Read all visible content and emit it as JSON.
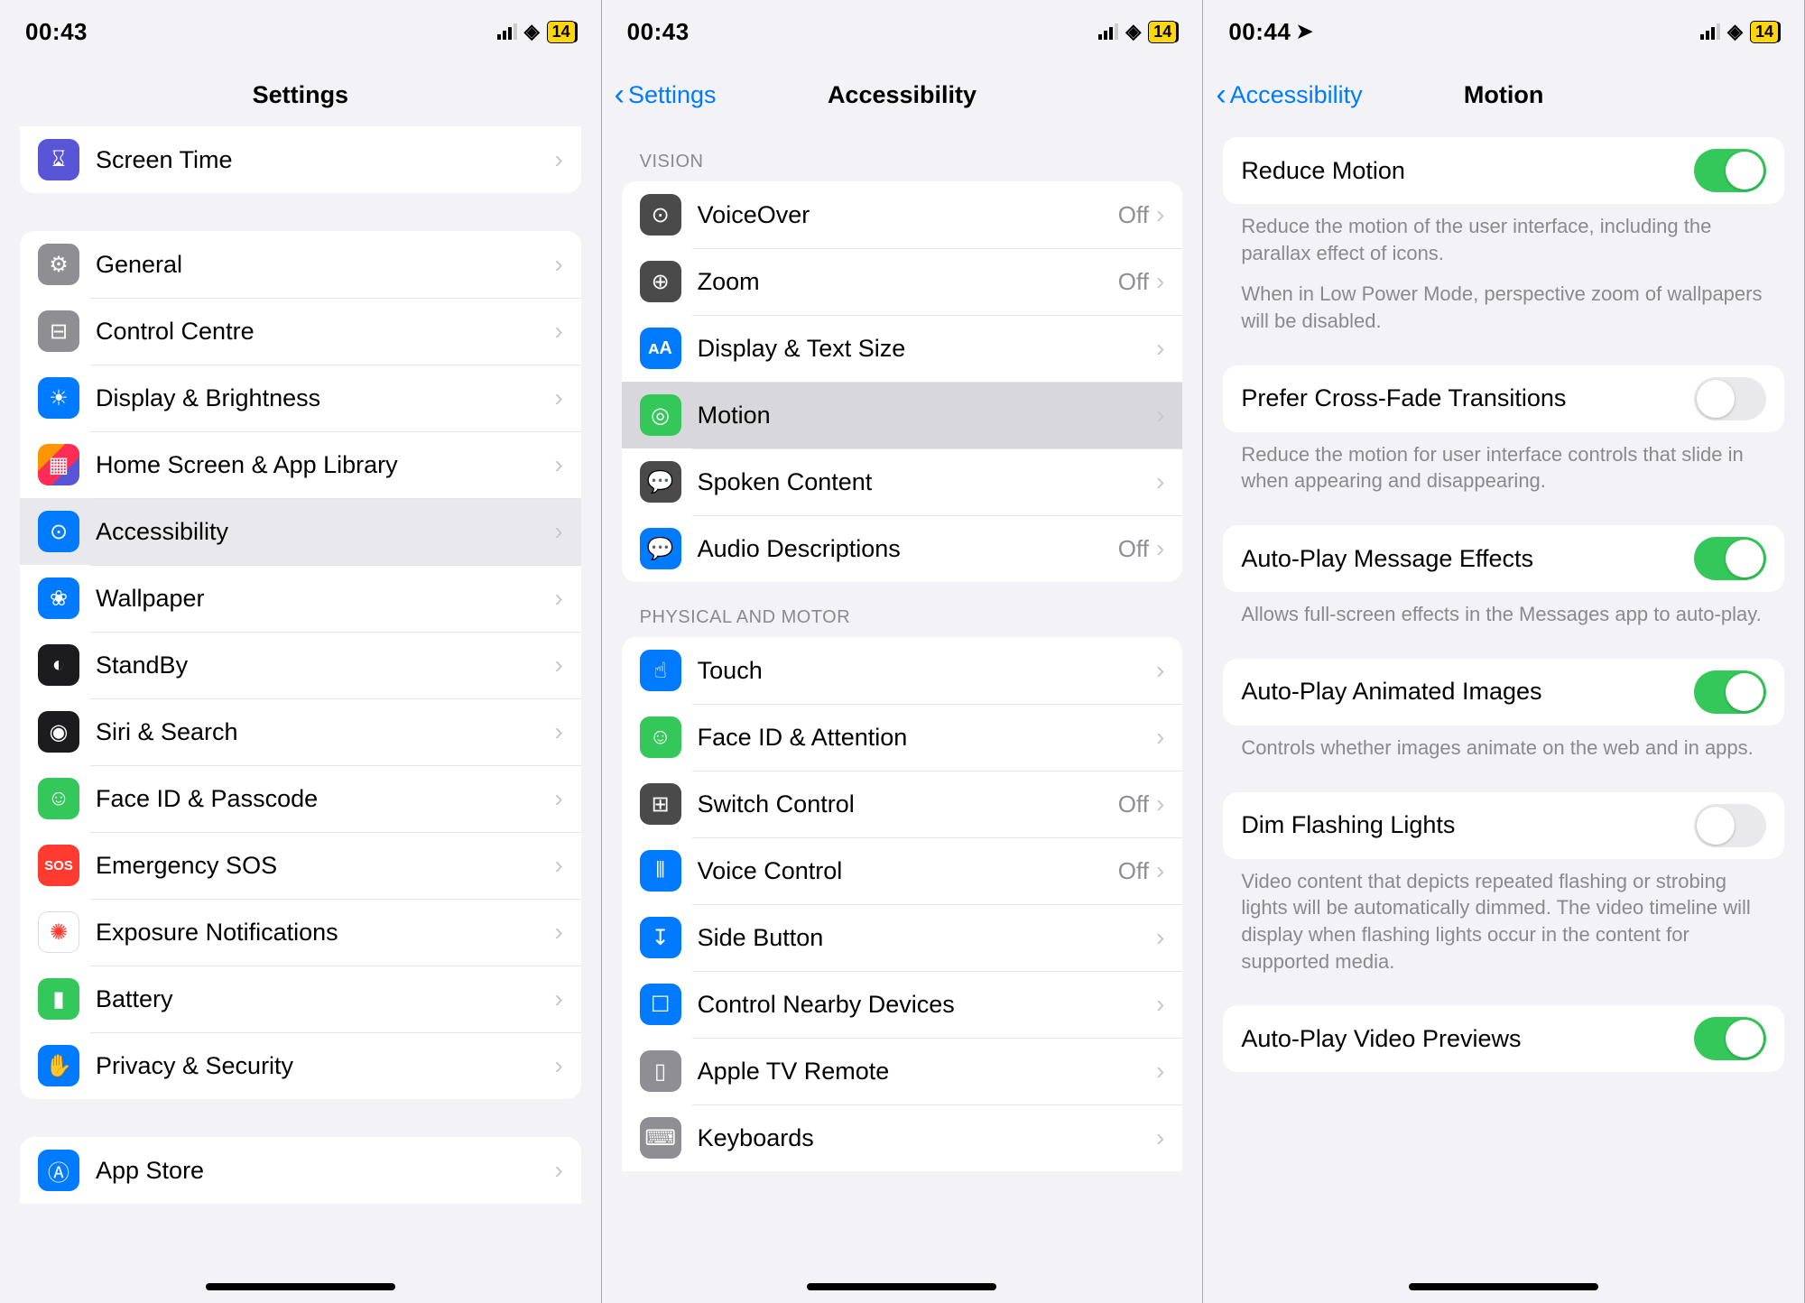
{
  "pane1": {
    "status": {
      "time": "00:43",
      "battery": "14"
    },
    "title": "Settings",
    "top_item": {
      "label": "Screen Time",
      "iconbg": "bg-purple",
      "glyph": "⌛︎"
    },
    "group": [
      {
        "label": "General",
        "iconbg": "bg-gray",
        "glyph": "⚙︎"
      },
      {
        "label": "Control Centre",
        "iconbg": "bg-gray",
        "glyph": "⊟"
      },
      {
        "label": "Display & Brightness",
        "iconbg": "bg-blue",
        "glyph": "☀︎"
      },
      {
        "label": "Home Screen & App Library",
        "iconbg": "bg-multicolor",
        "glyph": "▦"
      },
      {
        "label": "Accessibility",
        "iconbg": "bg-blue",
        "glyph": "⊙",
        "active": true
      },
      {
        "label": "Wallpaper",
        "iconbg": "bg-blue",
        "glyph": "❀"
      },
      {
        "label": "StandBy",
        "iconbg": "bg-black",
        "glyph": "◐"
      },
      {
        "label": "Siri & Search",
        "iconbg": "bg-black",
        "glyph": "◉"
      },
      {
        "label": "Face ID & Passcode",
        "iconbg": "bg-green",
        "glyph": "☺︎"
      },
      {
        "label": "Emergency SOS",
        "iconbg": "bg-red",
        "glyph": "SOS"
      },
      {
        "label": "Exposure Notifications",
        "iconbg": "bg-white",
        "glyph": "✺"
      },
      {
        "label": "Battery",
        "iconbg": "bg-green",
        "glyph": "▮"
      },
      {
        "label": "Privacy & Security",
        "iconbg": "bg-blue",
        "glyph": "✋"
      }
    ],
    "appstore": {
      "label": "App Store",
      "iconbg": "bg-blue",
      "glyph": "Ⓐ"
    }
  },
  "pane2": {
    "status": {
      "time": "00:43",
      "battery": "14"
    },
    "back": "Settings",
    "title": "Accessibility",
    "vision_header": "VISION",
    "vision": [
      {
        "label": "VoiceOver",
        "iconbg": "bg-darkgray",
        "glyph": "⊙",
        "value": "Off"
      },
      {
        "label": "Zoom",
        "iconbg": "bg-darkgray",
        "glyph": "⊕",
        "value": "Off"
      },
      {
        "label": "Display & Text Size",
        "iconbg": "bg-blue",
        "glyph": "ᴀA"
      },
      {
        "label": "Motion",
        "iconbg": "bg-green",
        "glyph": "◎",
        "selected": true
      },
      {
        "label": "Spoken Content",
        "iconbg": "bg-darkgray",
        "glyph": "💬"
      },
      {
        "label": "Audio Descriptions",
        "iconbg": "bg-blue",
        "glyph": "💬",
        "value": "Off"
      }
    ],
    "physical_header": "PHYSICAL AND MOTOR",
    "physical": [
      {
        "label": "Touch",
        "iconbg": "bg-blue",
        "glyph": "☝︎"
      },
      {
        "label": "Face ID & Attention",
        "iconbg": "bg-green",
        "glyph": "☺︎"
      },
      {
        "label": "Switch Control",
        "iconbg": "bg-darkgray",
        "glyph": "⊞",
        "value": "Off"
      },
      {
        "label": "Voice Control",
        "iconbg": "bg-blue",
        "glyph": "⦀",
        "value": "Off"
      },
      {
        "label": "Side Button",
        "iconbg": "bg-blue",
        "glyph": "↧"
      },
      {
        "label": "Control Nearby Devices",
        "iconbg": "bg-blue",
        "glyph": "☐"
      },
      {
        "label": "Apple TV Remote",
        "iconbg": "bg-gray",
        "glyph": "▯"
      },
      {
        "label": "Keyboards",
        "iconbg": "bg-gray",
        "glyph": "⌨︎"
      }
    ]
  },
  "pane3": {
    "status": {
      "time": "00:44",
      "battery": "14",
      "location": true
    },
    "back": "Accessibility",
    "title": "Motion",
    "items": [
      {
        "label": "Reduce Motion",
        "on": true,
        "footer1": "Reduce the motion of the user interface, including the parallax effect of icons.",
        "footer2": "When in Low Power Mode, perspective zoom of wallpapers will be disabled."
      },
      {
        "label": "Prefer Cross-Fade Transitions",
        "on": false,
        "footer1": "Reduce the motion for user interface controls that slide in when appearing and disappearing."
      },
      {
        "label": "Auto-Play Message Effects",
        "on": true,
        "footer1": "Allows full-screen effects in the Messages app to auto-play."
      },
      {
        "label": "Auto-Play Animated Images",
        "on": true,
        "footer1": "Controls whether images animate on the web and in apps."
      },
      {
        "label": "Dim Flashing Lights",
        "on": false,
        "footer1": "Video content that depicts repeated flashing or strobing lights will be automatically dimmed. The video timeline will display when flashing lights occur in the content for supported media."
      },
      {
        "label": "Auto-Play Video Previews",
        "on": true
      }
    ]
  }
}
